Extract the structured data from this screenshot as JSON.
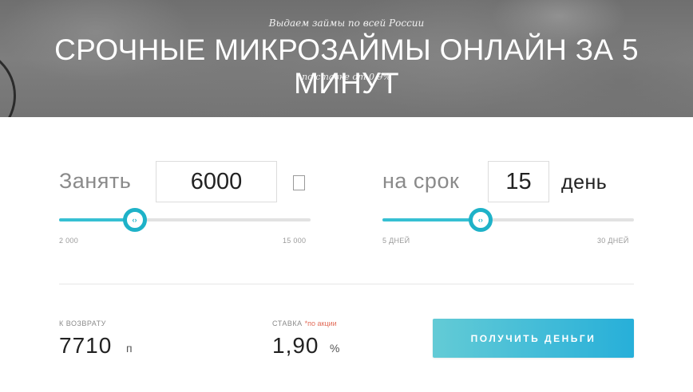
{
  "hero": {
    "subtitle": "Выдаем займы по всей России",
    "title": "СРОЧНЫЕ МИКРОЗАЙМЫ ОНЛАЙН ЗА 5 МИНУТ",
    "rate": "по ставке от 0,9%"
  },
  "amount": {
    "label": "Занять",
    "value": "6000",
    "unit_icon": "currency-icon",
    "slider_level_pct": 30,
    "min_label": "2 000",
    "max_label": "15 000",
    "knob_glyph": "‹›"
  },
  "term": {
    "label": "на срок",
    "value": "15",
    "unit": "день",
    "slider_level_pct": 39,
    "min_label": "5 ДНЕЙ",
    "max_label": "30 ДНЕЙ",
    "knob_glyph": "‹›"
  },
  "summary": {
    "return_label": "К ВОЗВРАТУ",
    "return_value": "7710",
    "return_unit": "п",
    "rate_label": "СТАВКА",
    "rate_promo": "*по акции",
    "rate_value": "1,90",
    "rate_unit": "%"
  },
  "cta": {
    "label": "ПОЛУЧИТЬ ДЕНЬГИ"
  },
  "colors": {
    "accent": "#1eb2c8",
    "button_start": "#63cbd6",
    "button_end": "#27afd9",
    "promo": "#e26d5a"
  }
}
